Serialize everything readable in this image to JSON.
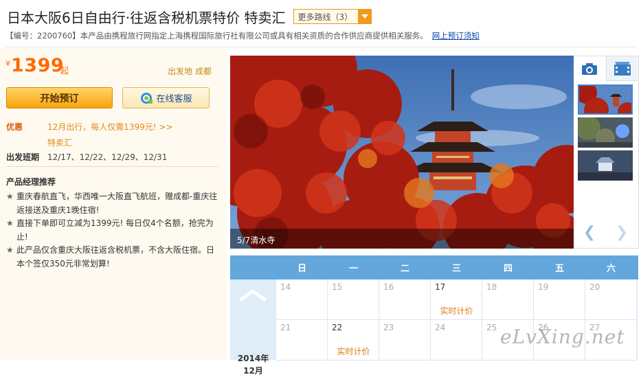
{
  "header": {
    "title": "日本大阪6日自由行·往返含税机票特价 特卖汇",
    "more_routes": "更多路线（3）",
    "desc": "【编号：2200760】本产品由携程旅行网指定上海携程国际旅行社有限公司或具有相关资质的合作供应商提供相关服务。",
    "desc_link": "网上预订须知"
  },
  "price": {
    "currency": "¥",
    "value": "1399",
    "suffix": "起",
    "depart": "出发地 成都"
  },
  "buttons": {
    "book": "开始预订",
    "service": "在线客服"
  },
  "promo": {
    "label": "优惠",
    "text": "12月出行，每人仅需1399元! >>",
    "tag": "特卖汇"
  },
  "schedule": {
    "label": "出发班期",
    "dates": "12/17、12/22、12/29、12/31"
  },
  "recommend": {
    "title": "产品经理推荐",
    "items": [
      "重庆春航直飞，华西唯一大阪直飞航班，赠成都-重庆往返接送及重庆1晚住宿!",
      "直接下单即可立减为1399元! 每日仅4个名额，抢完为止!",
      "此产品仅含重庆大阪往返含税机票，不含大阪住宿。日本个签仅350元非常划算!"
    ]
  },
  "gallery": {
    "caption": "5/7清水寺",
    "current": 5,
    "total": 7
  },
  "calendar": {
    "weekdays": [
      "日",
      "一",
      "二",
      "三",
      "四",
      "五",
      "六"
    ],
    "month_year": "2014年",
    "month": "12月",
    "realtime_label": "实时计价",
    "rows": [
      [
        {
          "d": "14",
          "active": false,
          "price": false
        },
        {
          "d": "15",
          "active": false,
          "price": false
        },
        {
          "d": "16",
          "active": false,
          "price": false
        },
        {
          "d": "17",
          "active": true,
          "price": true
        },
        {
          "d": "18",
          "active": false,
          "price": false
        },
        {
          "d": "19",
          "active": false,
          "price": false
        },
        {
          "d": "20",
          "active": false,
          "price": false
        }
      ],
      [
        {
          "d": "21",
          "active": false,
          "price": false
        },
        {
          "d": "22",
          "active": true,
          "price": true
        },
        {
          "d": "23",
          "active": false,
          "price": false
        },
        {
          "d": "24",
          "active": false,
          "price": false
        },
        {
          "d": "25",
          "active": false,
          "price": false
        },
        {
          "d": "26",
          "active": false,
          "price": false
        },
        {
          "d": "27",
          "active": false,
          "price": false
        }
      ]
    ]
  },
  "watermark": "eLvXing.net",
  "colors": {
    "accent_orange": "#ff6a00",
    "calendar_blue": "#63a7dd",
    "link_blue": "#0b46a8"
  }
}
